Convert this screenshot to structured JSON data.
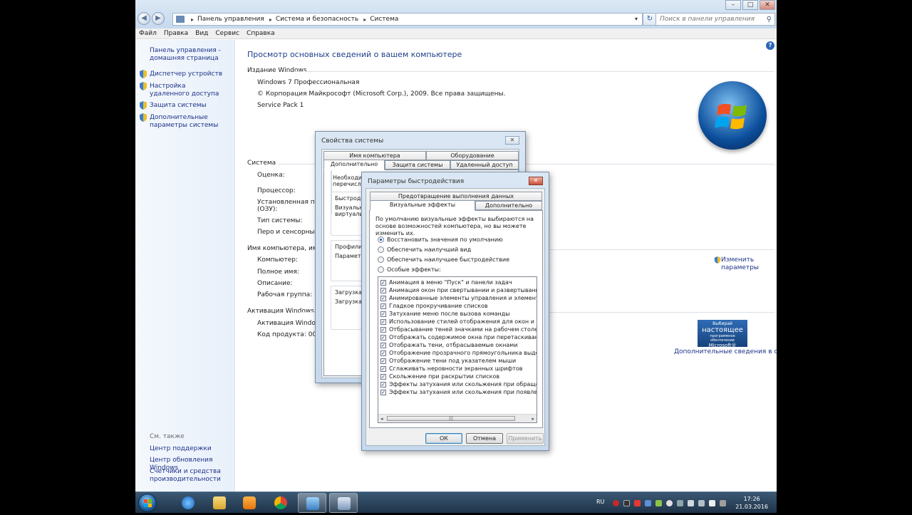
{
  "window": {
    "breadcrumbs": [
      "Панель управления",
      "Система и безопасность",
      "Система"
    ],
    "search_placeholder": "Поиск в панели управления",
    "menu": [
      "Файл",
      "Правка",
      "Вид",
      "Сервис",
      "Справка"
    ]
  },
  "left_pane": {
    "home_link": "Панель управления - домашняя страница",
    "links": [
      "Диспетчер устройств",
      "Настройка удаленного доступа",
      "Защита системы",
      "Дополнительные параметры системы"
    ],
    "see_also_heading": "См. также",
    "see_also": [
      "Центр поддержки",
      "Центр обновления Windows",
      "Счетчики и средства производительности"
    ]
  },
  "main": {
    "title": "Просмотр основных сведений о вашем компьютере",
    "edition_heading": "Издание Windows",
    "edition": "Windows 7 Профессиональная",
    "copyright": "© Корпорация Майкрософт (Microsoft Corp.), 2009. Все права защищены.",
    "service_pack": "Service Pack 1",
    "system_heading": "Система",
    "system_labels": [
      "Оценка:",
      "Процессор:",
      "Установленная памя",
      "(ОЗУ):",
      "Тип системы:",
      "Перо и сенсорный в"
    ],
    "computer_heading": "Имя компьютера, имя до",
    "computer_labels": [
      "Компьютер:",
      "Полное имя:",
      "Описание:",
      "Рабочая группа:"
    ],
    "change_link": "Изменить параметры",
    "activation_heading": "Активация Windows",
    "activation_text": "Активация Windows в",
    "product_key": "Код продукта: 00371-",
    "genuine_small": "Выбирай",
    "genuine_big": "настоящее",
    "genuine_sub": "программное обеспечение",
    "genuine_brand": "Microsoft®",
    "more_info_link": "Дополнительные сведения в сети..."
  },
  "sys_props": {
    "title": "Свойства системы",
    "tabs_top": [
      "Имя компьютера",
      "Оборудование"
    ],
    "tabs_bottom": [
      "Дополнительно",
      "Защита системы",
      "Удаленный доступ"
    ],
    "text_1": "Необходим",
    "text_2": "перечислен",
    "group_perf": "Быстроде",
    "perf_1": "Визуальн",
    "perf_2": "виртуальн",
    "group_profiles": "Профили п",
    "profiles_1": "Параметр",
    "group_boot": "Загрузка и",
    "boot_1": "Загрузка и"
  },
  "perf_opts": {
    "title": "Параметры быстродействия",
    "tab_dep": "Предотвращение выполнения данных",
    "tab_visual": "Визуальные эффекты",
    "tab_advanced": "Дополнительно",
    "description": "По умолчанию визуальные эффекты выбираются на основе возможностей компьютера, но вы можете изменить их.",
    "radios": [
      "Восстановить значения по умолчанию",
      "Обеспечить наилучший вид",
      "Обеспечить наилучшее быстродействие",
      "Особые эффекты:"
    ],
    "selected_radio": 0,
    "effects": [
      "Анимация в меню \"Пуск\" и панели задач",
      "Анимация окон при свертывании и развертывании",
      "Анимированные элементы управления и элементы внутри",
      "Гладкое прокручивание списков",
      "Затухание меню после вызова команды",
      "Использование стилей отображения для окон и кнопок",
      "Отбрасывание теней значками на рабочем столе",
      "Отображать содержимое окна при перетаскивании",
      "Отображать тени, отбрасываемые окнами",
      "Отображение прозрачного прямоугольника выделения",
      "Отображение тени под указателем мыши",
      "Сглаживать неровности экранных шрифтов",
      "Скольжение при раскрытии списков",
      "Эффекты затухания или скольжения при обращении к ме",
      "Эффекты затухания или скольжения при появлении подс"
    ],
    "scroll_thumb": "|||",
    "ok": "ОК",
    "cancel": "Отмена",
    "apply": "Применить"
  },
  "taskbar": {
    "lang": "RU",
    "time": "17:26",
    "date": "21.03.2016"
  }
}
